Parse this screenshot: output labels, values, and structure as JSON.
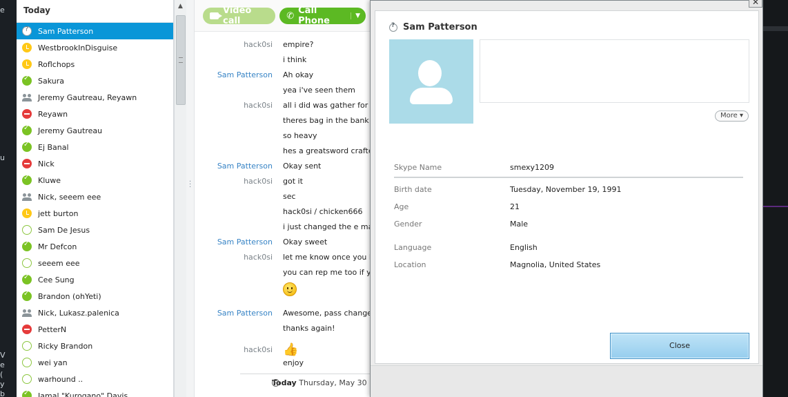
{
  "left_edge_glyphs": [
    "e",
    "u",
    "V",
    "e",
    "(",
    "y",
    "b"
  ],
  "contacts": {
    "header": "Today",
    "items": [
      {
        "name": "Sam Patterson",
        "status": "unknown",
        "selected": true
      },
      {
        "name": "WestbrookInDisguise",
        "status": "away"
      },
      {
        "name": "Roflchops",
        "status": "away"
      },
      {
        "name": "Sakura",
        "status": "online"
      },
      {
        "name": "Jeremy Gautreau, Reyawn",
        "status": "group"
      },
      {
        "name": "Reyawn",
        "status": "dnd"
      },
      {
        "name": "Jeremy Gautreau",
        "status": "online"
      },
      {
        "name": "Ej Banal",
        "status": "online"
      },
      {
        "name": "Nick",
        "status": "dnd"
      },
      {
        "name": "Kluwe",
        "status": "online"
      },
      {
        "name": "Nick, seeem eee",
        "status": "group"
      },
      {
        "name": "jett burton",
        "status": "away"
      },
      {
        "name": "Sam De Jesus",
        "status": "offline"
      },
      {
        "name": "Mr Defcon",
        "status": "online"
      },
      {
        "name": "seeem eee",
        "status": "offline"
      },
      {
        "name": "Cee Sung",
        "status": "online"
      },
      {
        "name": "Brandon (ohYeti)",
        "status": "online"
      },
      {
        "name": "Nick, Lukasz.palenica",
        "status": "group"
      },
      {
        "name": "PetterN",
        "status": "dnd"
      },
      {
        "name": "Ricky Brandon",
        "status": "offline"
      },
      {
        "name": "wei yan",
        "status": "offline"
      },
      {
        "name": "warhound ..",
        "status": "offline"
      },
      {
        "name": "Jamal \"Kurogano\" Davis",
        "status": "online"
      }
    ]
  },
  "toolbar": {
    "video_call": "Video call",
    "call_phone": "Call Phone",
    "dropdown": "▼"
  },
  "chat": {
    "messages": [
      {
        "sender": "hack0si",
        "text": "empire?",
        "type": "text",
        "sender_color": "gray"
      },
      {
        "sender": "",
        "text": "i think",
        "type": "text"
      },
      {
        "sender": "Sam Patterson",
        "text": "Ah okay",
        "type": "text",
        "sender_color": "blue"
      },
      {
        "sender": "",
        "text": "yea i've seen them",
        "type": "text"
      },
      {
        "sender": "hack0si",
        "text": "all i did was gather for the",
        "type": "text",
        "sender_color": "gray"
      },
      {
        "sender": "",
        "text": "theres bag in the bank cal",
        "type": "text"
      },
      {
        "sender": "",
        "text": "so heavy",
        "type": "text"
      },
      {
        "sender": "",
        "text": "hes a greatsword crafter",
        "type": "text"
      },
      {
        "sender": "Sam Patterson",
        "text": "Okay sent",
        "type": "text",
        "sender_color": "blue"
      },
      {
        "sender": "hack0si",
        "text": "got it",
        "type": "text",
        "sender_color": "gray"
      },
      {
        "sender": "",
        "text": "sec",
        "type": "text"
      },
      {
        "sender": "",
        "text": "hack0si / chicken666",
        "type": "text"
      },
      {
        "sender": "",
        "text": "i just changed the e mail t",
        "type": "text"
      },
      {
        "sender": "Sam Patterson",
        "text": "Okay sweet",
        "type": "text",
        "sender_color": "blue"
      },
      {
        "sender": "hack0si",
        "text": "let me know once you log",
        "type": "text",
        "sender_color": "gray"
      },
      {
        "sender": "",
        "text": "you can rep me too if you",
        "type": "text"
      },
      {
        "sender": "",
        "text": "",
        "type": "smile-emoticon"
      },
      {
        "sender": "Sam Patterson",
        "text": "Awesome, pass changed,",
        "type": "text",
        "sender_color": "blue"
      },
      {
        "sender": "",
        "text": "thanks again!",
        "type": "text"
      },
      {
        "sender": "hack0si",
        "text": "",
        "type": "thumbs-up-emoticon",
        "sender_color": "gray"
      },
      {
        "sender": "",
        "text": "enjoy",
        "type": "text"
      }
    ],
    "date_separator": {
      "bold": "Today",
      "rest": "Thursday, May 30"
    }
  },
  "profile": {
    "title": "Sam Patterson",
    "more_label": "More",
    "more_caret": "▾",
    "fields": [
      {
        "label": "Skype Name",
        "value": "smexy1209"
      },
      {
        "label": "Birth date",
        "value": "Tuesday, November 19, 1991"
      },
      {
        "label": "Age",
        "value": "21"
      },
      {
        "label": "Gender",
        "value": "Male"
      },
      {
        "label": "Language",
        "value": "English"
      },
      {
        "label": "Location",
        "value": "Magnolia, United States"
      }
    ],
    "close_label": "Close",
    "close_x": "✕"
  },
  "colors": {
    "selection": "#0a96d8",
    "sender_blue": "#3683c5",
    "call_green": "#5cb923",
    "avatar_bg": "#abdbe8"
  }
}
